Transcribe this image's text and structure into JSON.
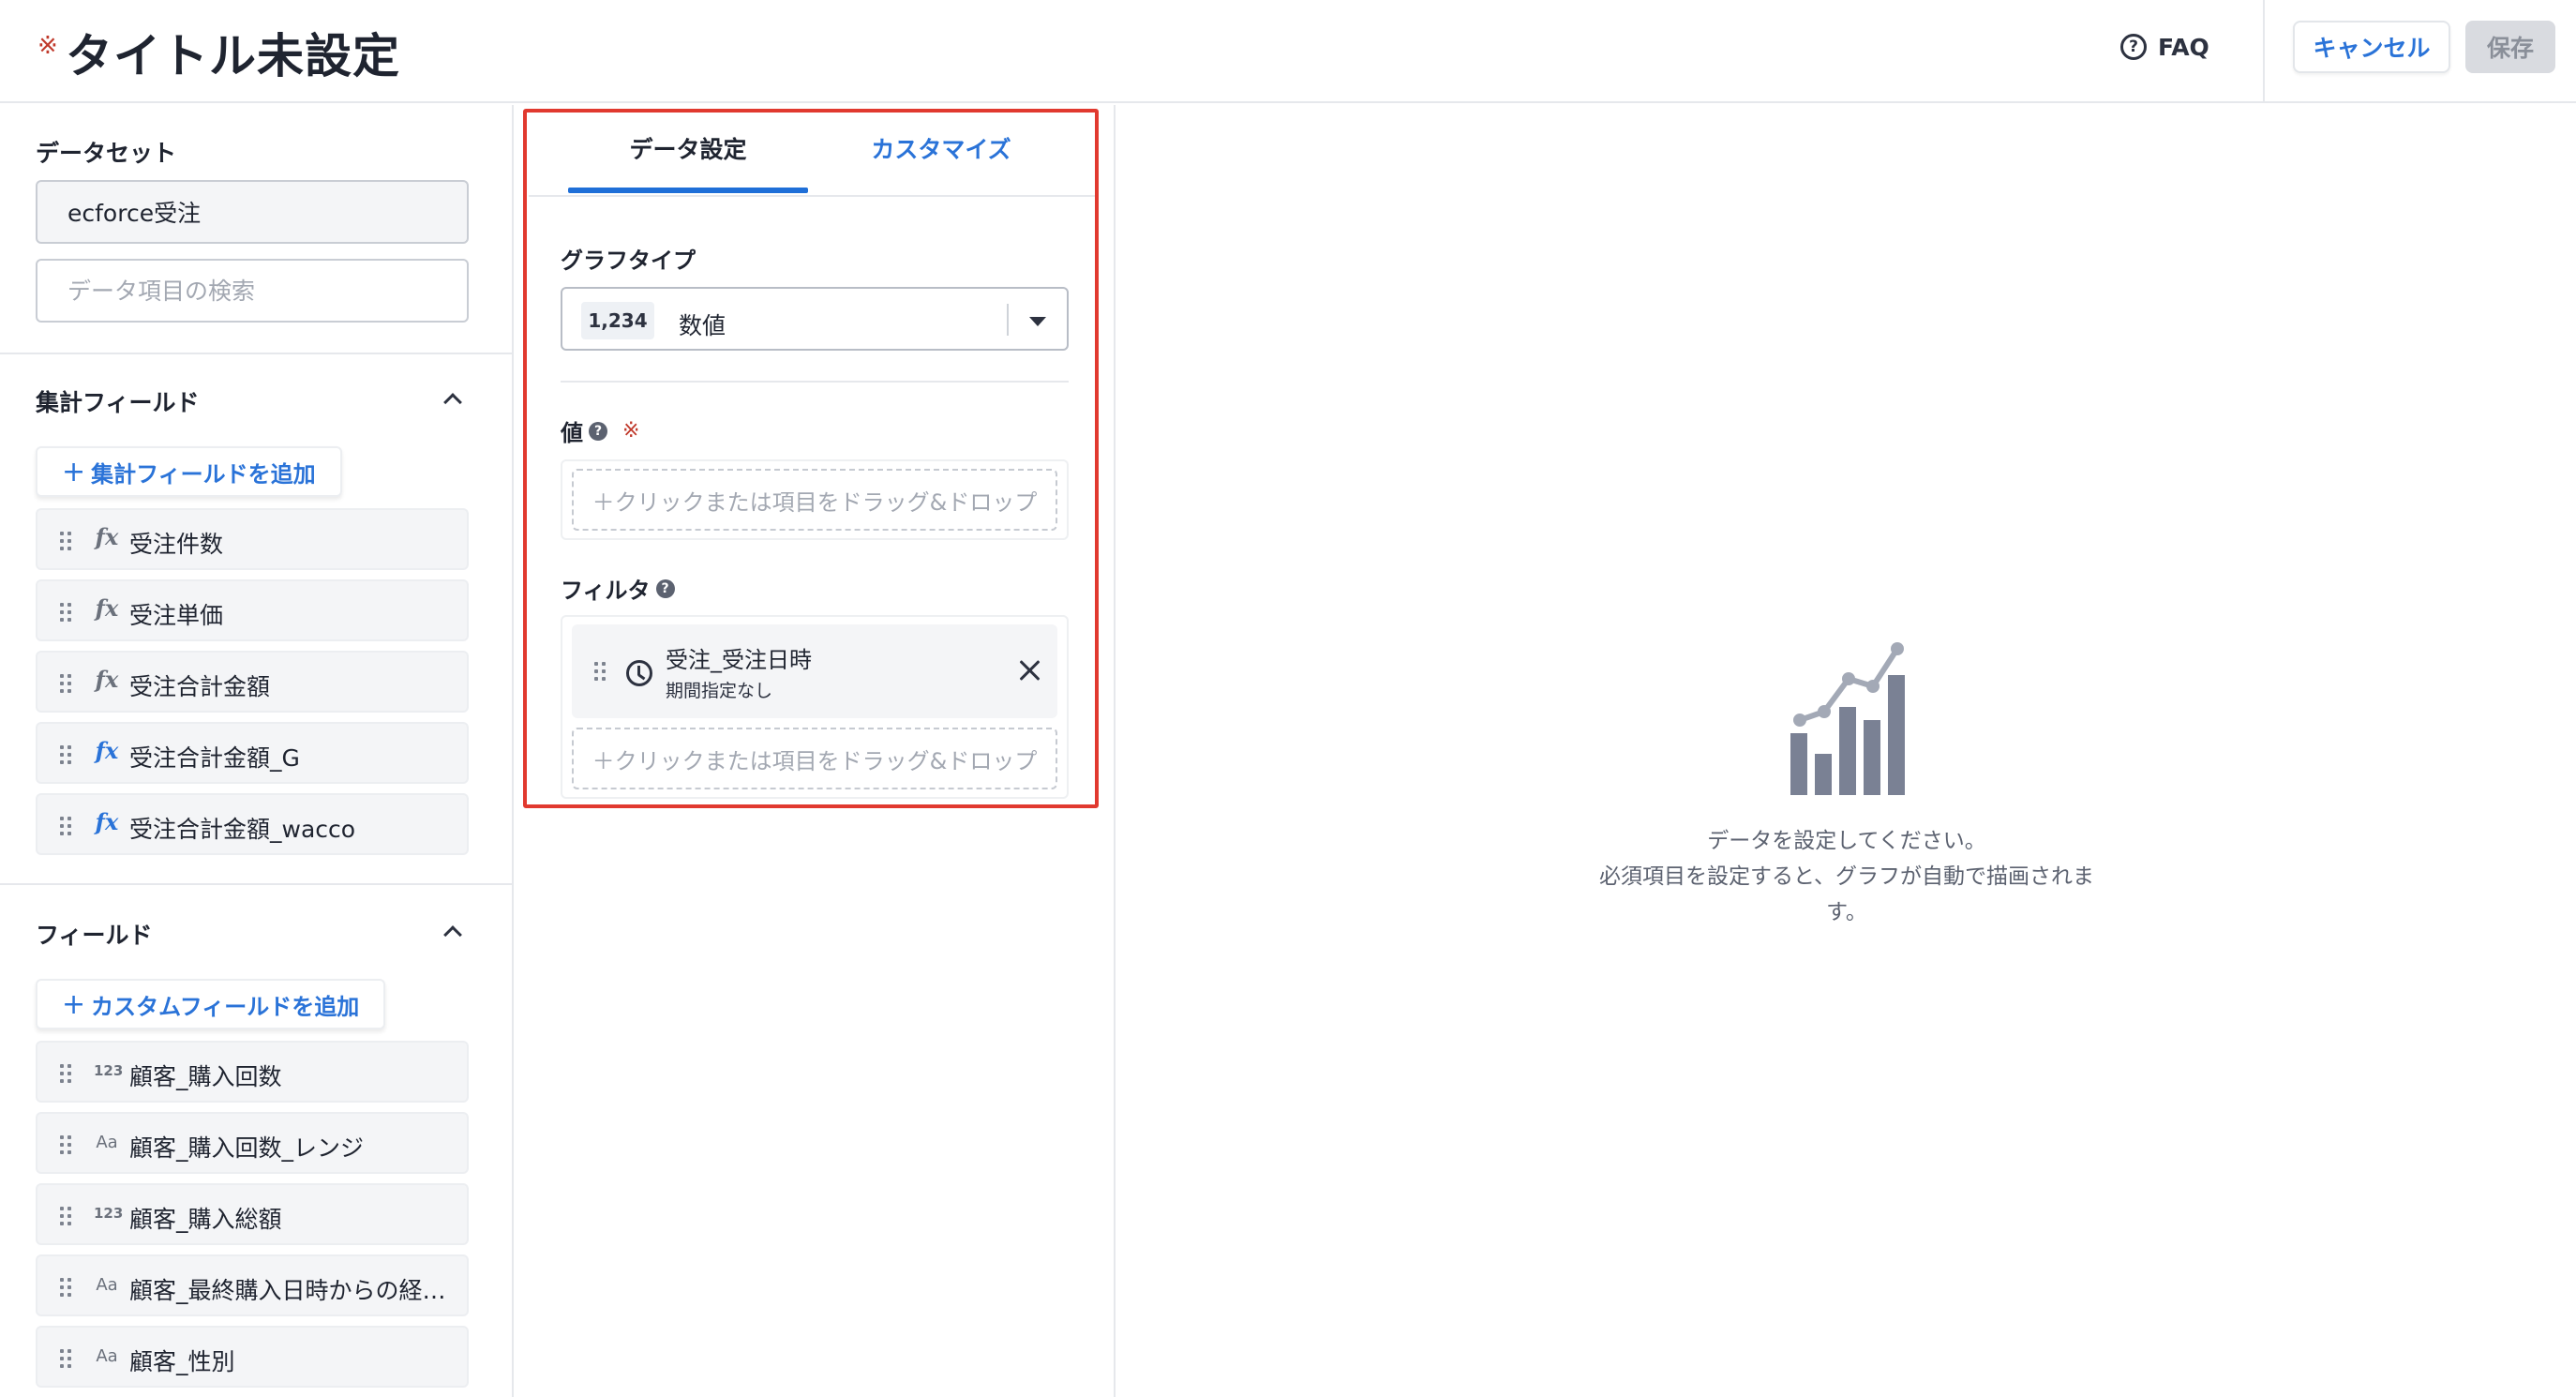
{
  "header": {
    "title_mark": "※",
    "title": "タイトル未設定",
    "faq_icon": "?",
    "faq_label": "FAQ",
    "cancel_label": "キャンセル",
    "save_label": "保存"
  },
  "left": {
    "dataset_label": "データセット",
    "dataset_value": "ecforce受注",
    "search_placeholder": "データ項目の検索",
    "agg_section": {
      "title": "集計フィールド",
      "add_label": "集計フィールドを追加",
      "items": [
        {
          "type": "fx",
          "name": "受注件数"
        },
        {
          "type": "fx",
          "name": "受注単価"
        },
        {
          "type": "fx",
          "name": "受注合計金額"
        },
        {
          "type": "fx-custom",
          "name": "受注合計金額_G"
        },
        {
          "type": "fx-custom",
          "name": "受注合計金額_wacco"
        }
      ]
    },
    "field_section": {
      "title": "フィールド",
      "add_label": "カスタムフィールドを追加",
      "items": [
        {
          "type": "123",
          "name": "顧客_購入回数"
        },
        {
          "type": "Aa",
          "name": "顧客_購入回数_レンジ"
        },
        {
          "type": "123",
          "name": "顧客_購入総額"
        },
        {
          "type": "Aa",
          "name": "顧客_最終購入日時からの経…"
        },
        {
          "type": "Aa",
          "name": "顧客_性別"
        }
      ]
    }
  },
  "middle": {
    "tabs": [
      {
        "label": "データ設定",
        "active": true
      },
      {
        "label": "カスタマイズ",
        "active": false
      }
    ],
    "graph_type_label": "グラフタイプ",
    "graph_type_chip": "1,234",
    "graph_type_value": "数値",
    "value_label": "値",
    "required_mark": "※",
    "help_icon": "?",
    "drop_placeholder": "＋クリックまたは項目をドラッグ&ドロップ",
    "filter_label": "フィルタ",
    "filter_item": {
      "name": "受注_受注日時",
      "sub": "期間指定なし"
    }
  },
  "right": {
    "empty_line1": "データを設定してください。",
    "empty_line2": "必須項目を設定すると、グラフが自動で描画されます。"
  },
  "colors": {
    "accent": "#2a73d8",
    "required": "#c0392b",
    "highlight_frame": "#e1392f",
    "icon_gray": "#7a8194"
  }
}
